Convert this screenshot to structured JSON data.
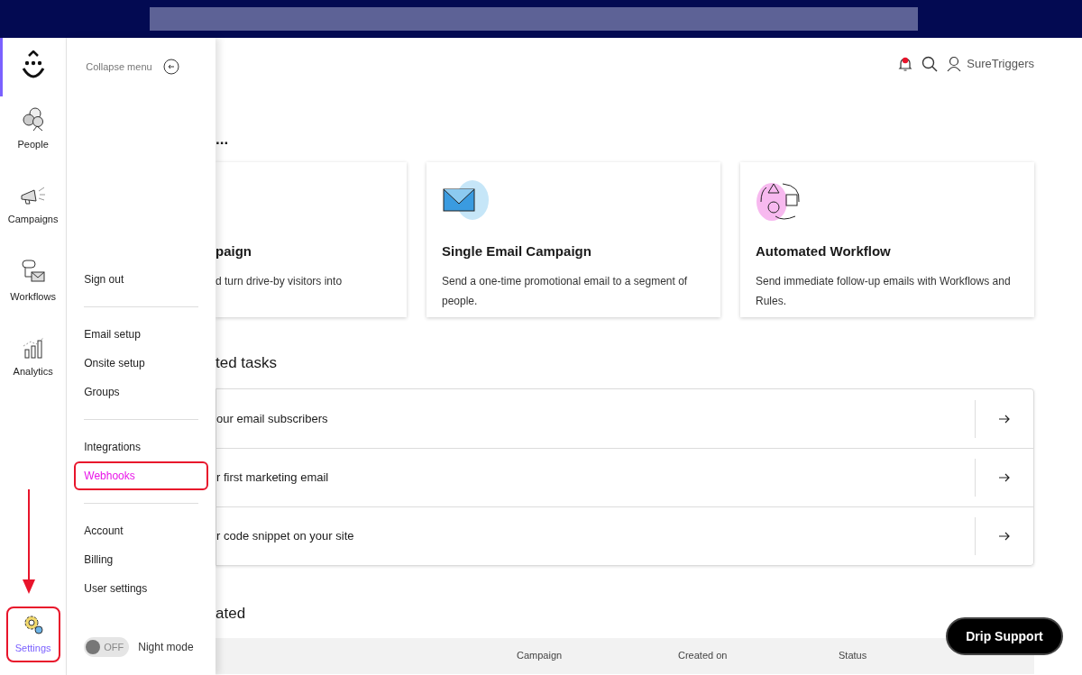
{
  "rail": {
    "items": [
      {
        "label": "People",
        "kind": "people",
        "selected": false,
        "highlighted": false
      },
      {
        "label": "Campaigns",
        "kind": "megaphone",
        "selected": false,
        "highlighted": false
      },
      {
        "label": "Workflows",
        "kind": "workflow",
        "selected": false,
        "highlighted": false
      },
      {
        "label": "Analytics",
        "kind": "chart",
        "selected": false,
        "highlighted": false
      },
      {
        "label": "Settings",
        "kind": "gear",
        "selected": true,
        "highlighted": true
      }
    ]
  },
  "menu": {
    "collapse_label": "Collapse menu",
    "groups": [
      [
        {
          "label": "Sign out",
          "selected": false,
          "highlighted": false
        }
      ],
      [
        {
          "label": "Email setup",
          "selected": false,
          "highlighted": false
        },
        {
          "label": "Onsite setup",
          "selected": false,
          "highlighted": false
        },
        {
          "label": "Groups",
          "selected": false,
          "highlighted": false
        }
      ],
      [
        {
          "label": "Integrations",
          "selected": false,
          "highlighted": false
        },
        {
          "label": "Webhooks",
          "selected": true,
          "highlighted": true
        }
      ],
      [
        {
          "label": "Account",
          "selected": false,
          "highlighted": false
        },
        {
          "label": "Billing",
          "selected": false,
          "highlighted": false
        },
        {
          "label": "User settings",
          "selected": false,
          "highlighted": false
        }
      ]
    ],
    "night_mode": {
      "label": "Night mode",
      "toggle_text": "OFF",
      "on": false
    }
  },
  "header": {
    "user": "SureTriggers"
  },
  "create": {
    "heading": "...",
    "cards": [
      {
        "title": "paign",
        "description": "d turn drive-by visitors into",
        "kind": "plain"
      },
      {
        "title": "Single Email Campaign",
        "description": "Send a one-time promotional email to a segment of people.",
        "kind": "envelope"
      },
      {
        "title": "Automated Workflow",
        "description": "Send immediate follow-up emails with Workflows and Rules.",
        "kind": "shapes"
      }
    ]
  },
  "tasks": {
    "heading": "ted tasks",
    "rows": [
      {
        "label": "our email subscribers"
      },
      {
        "label": "r first marketing email"
      },
      {
        "label": "r code snippet on your site"
      }
    ]
  },
  "recent": {
    "heading": "ated",
    "columns": [
      "Campaign",
      "Created on",
      "Status"
    ]
  },
  "support_button": "Drip Support"
}
